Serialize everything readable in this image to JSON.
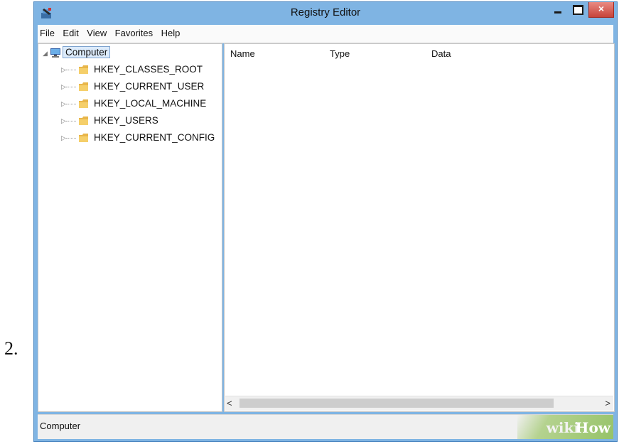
{
  "step_number": "2.",
  "window": {
    "title": "Registry Editor",
    "close_glyph": "×",
    "colors": {
      "frame": "#7fb4e3",
      "close": "#c7433a",
      "selection": "#dcebfb"
    }
  },
  "menu": [
    "File",
    "Edit",
    "View",
    "Favorites",
    "Help"
  ],
  "tree": {
    "root": {
      "label": "Computer",
      "icon": "computer-icon"
    },
    "keys": [
      {
        "label": "HKEY_CLASSES_ROOT",
        "icon": "folder-icon"
      },
      {
        "label": "HKEY_CURRENT_USER",
        "icon": "folder-icon"
      },
      {
        "label": "HKEY_LOCAL_MACHINE",
        "icon": "folder-icon"
      },
      {
        "label": "HKEY_USERS",
        "icon": "folder-icon"
      },
      {
        "label": "HKEY_CURRENT_CONFIG",
        "icon": "folder-icon"
      }
    ]
  },
  "list": {
    "columns": [
      "Name",
      "Type",
      "Data"
    ]
  },
  "scrollbar": {
    "left_glyph": "<",
    "right_glyph": ">"
  },
  "status": {
    "text": "Computer"
  },
  "watermark": {
    "part1": "wiki",
    "part2": "How"
  }
}
